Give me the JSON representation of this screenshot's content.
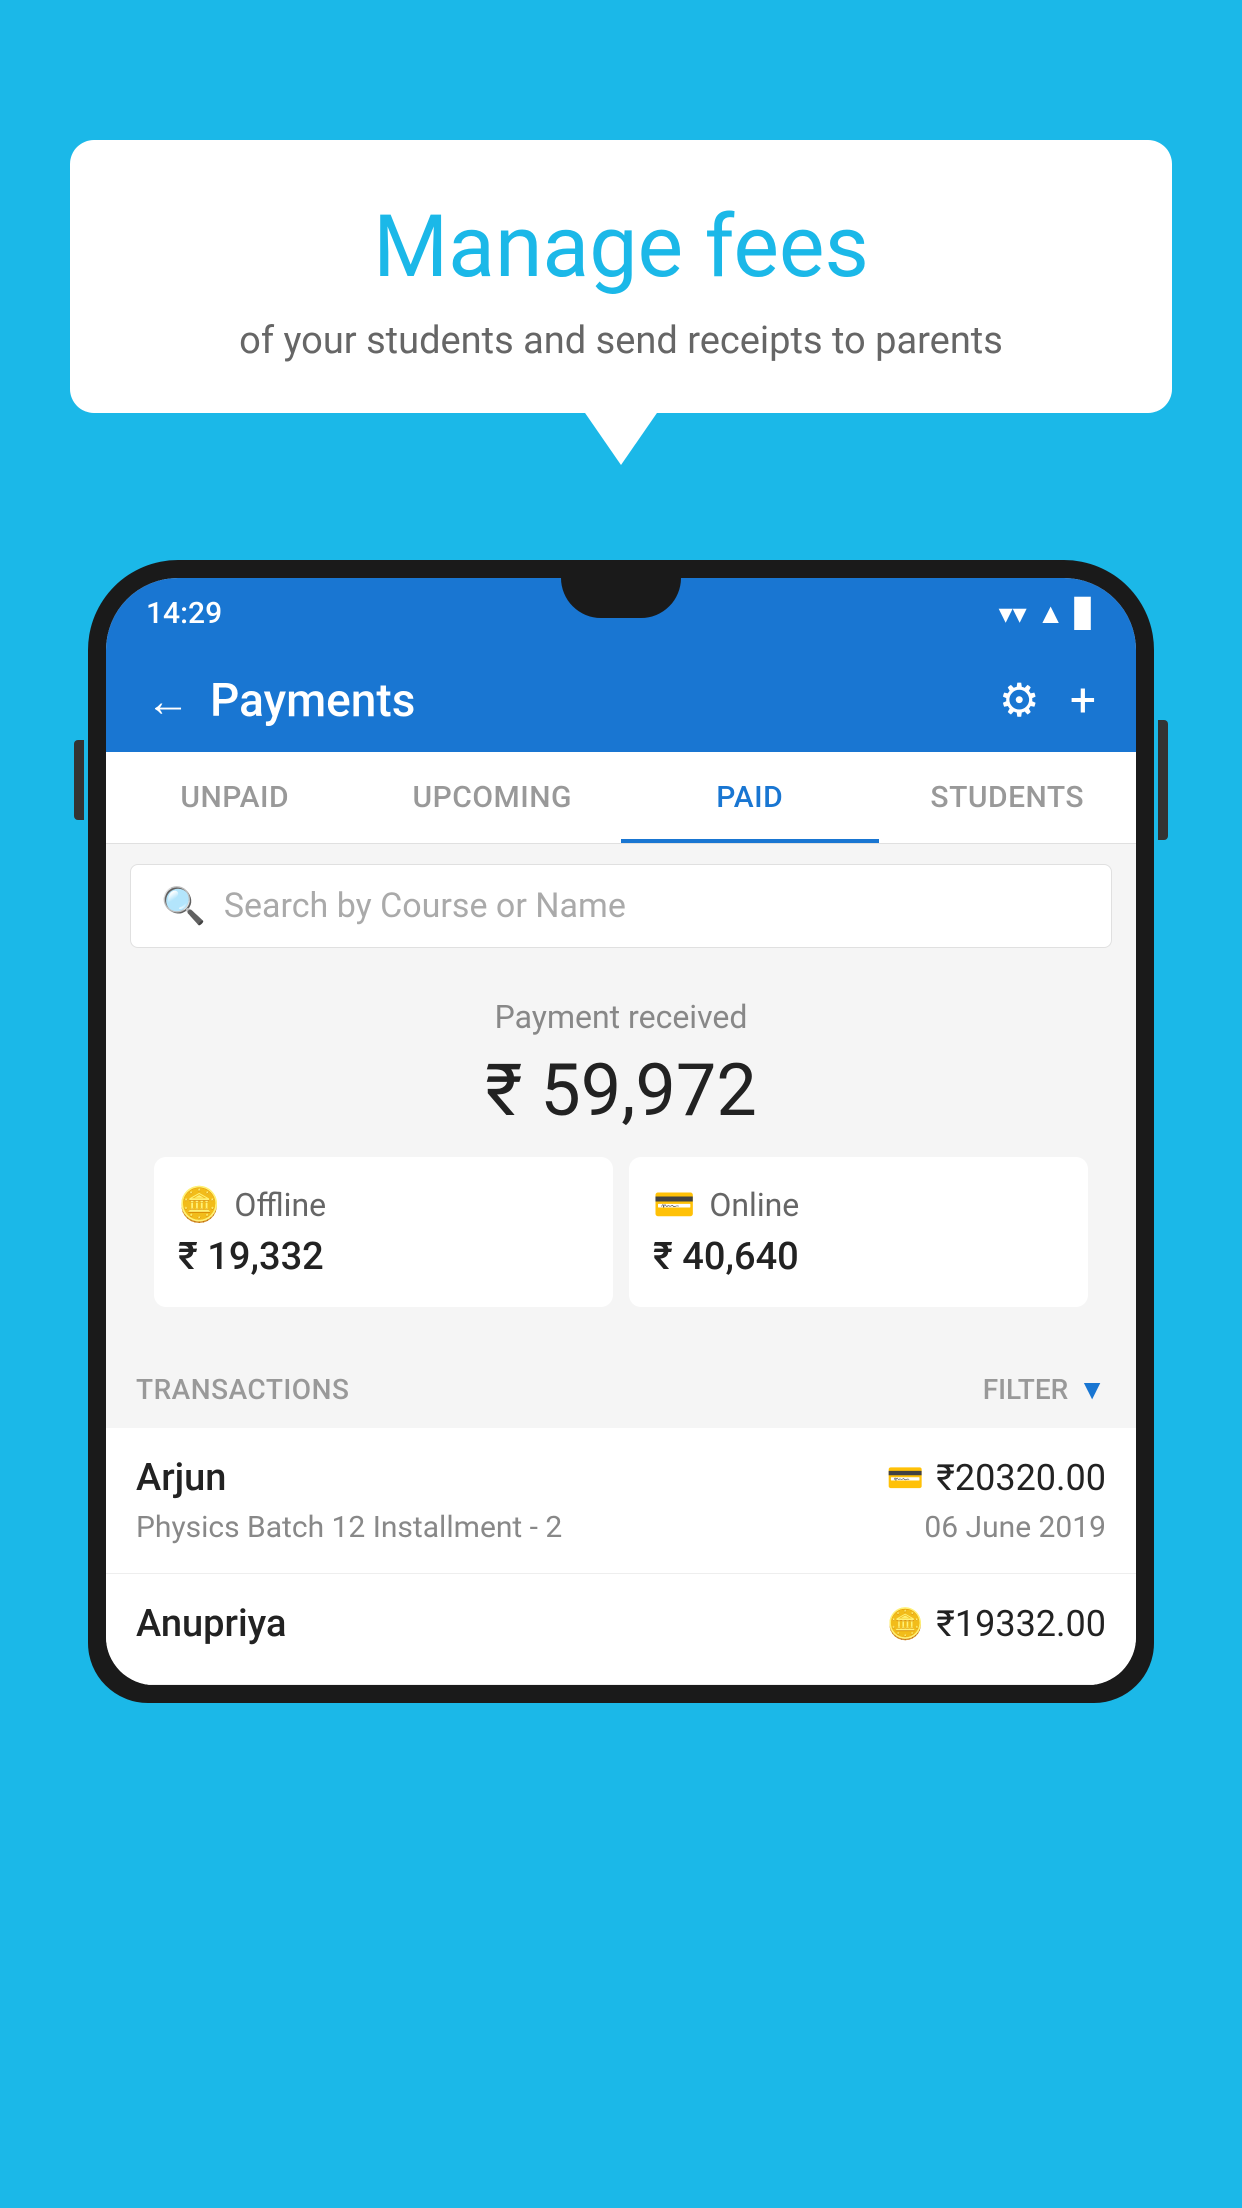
{
  "background": {
    "color": "#1BB8E8"
  },
  "speech_bubble": {
    "title": "Manage fees",
    "subtitle": "of your students and send receipts to parents"
  },
  "status_bar": {
    "time": "14:29",
    "wifi": "▼",
    "signal": "▲",
    "battery": "▊"
  },
  "header": {
    "title": "Payments",
    "back_label": "←",
    "gear_label": "⚙",
    "plus_label": "+"
  },
  "tabs": [
    {
      "label": "UNPAID",
      "active": false
    },
    {
      "label": "UPCOMING",
      "active": false
    },
    {
      "label": "PAID",
      "active": true
    },
    {
      "label": "STUDENTS",
      "active": false
    }
  ],
  "search": {
    "placeholder": "Search by Course or Name"
  },
  "payment_summary": {
    "received_label": "Payment received",
    "amount": "₹ 59,972"
  },
  "payment_cards": [
    {
      "icon": "offline",
      "label": "Offline",
      "amount": "₹ 19,332"
    },
    {
      "icon": "online",
      "label": "Online",
      "amount": "₹ 40,640"
    }
  ],
  "transactions_section": {
    "label": "TRANSACTIONS",
    "filter_label": "FILTER"
  },
  "transactions": [
    {
      "name": "Arjun",
      "icon": "card",
      "amount": "₹20320.00",
      "course": "Physics Batch 12 Installment - 2",
      "date": "06 June 2019"
    },
    {
      "name": "Anupriya",
      "icon": "cash",
      "amount": "₹19332.00",
      "course": "",
      "date": ""
    }
  ]
}
